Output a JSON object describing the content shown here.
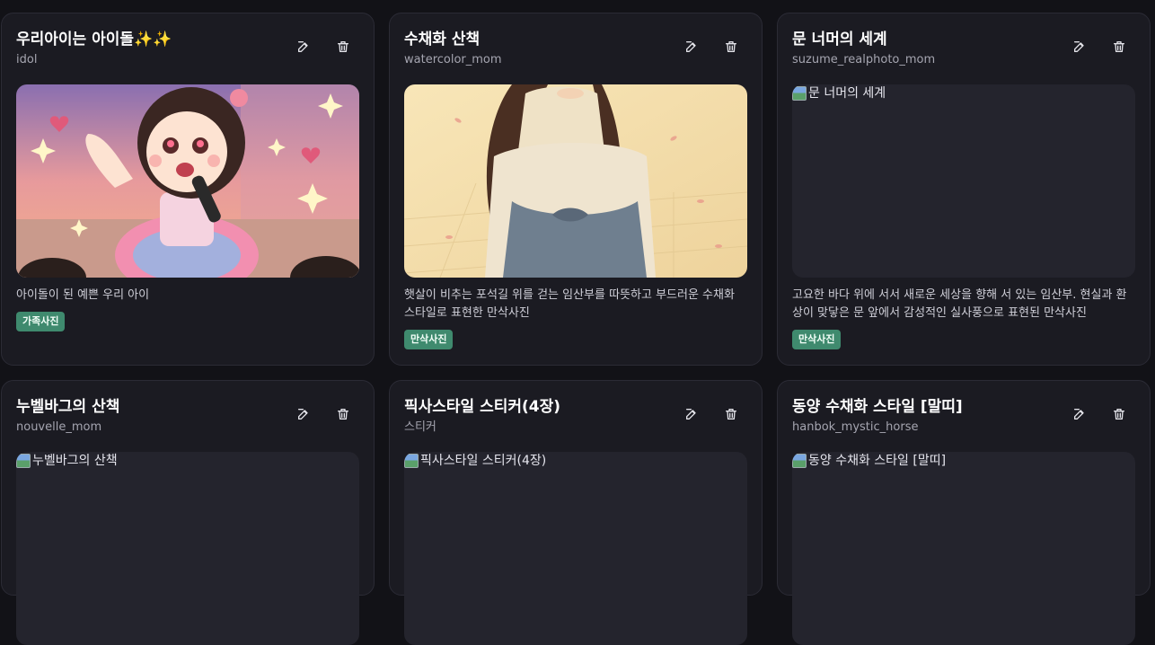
{
  "cards": [
    {
      "title": "우리아이는 아이돌✨✨",
      "author": "idol",
      "description": "아이돌이 된 예쁜 우리 아이",
      "tag": "가족사진",
      "image_alt": ""
    },
    {
      "title": "수채화 산책",
      "author": "watercolor_mom",
      "description": "햇살이 비추는 포석길 위를 걷는 임산부를 따뜻하고 부드러운 수채화 스타일로 표현한 만삭사진",
      "tag": "만삭사진",
      "image_alt": ""
    },
    {
      "title": "문 너머의 세계",
      "author": "suzume_realphoto_mom",
      "description": "고요한 바다 위에 서서 새로운 세상을 향해 서 있는 임산부. 현실과 환상이 맞닿은 문 앞에서 감성적인 실사풍으로 표현된 만삭사진",
      "tag": "만삭사진",
      "image_alt": "문 너머의 세계"
    },
    {
      "title": "누벨바그의 산책",
      "author": "nouvelle_mom",
      "image_alt": "누벨바그의 산책"
    },
    {
      "title": "픽사스타일 스티커(4장)",
      "author": "스티커",
      "image_alt": "픽사스타일 스티커(4장)"
    },
    {
      "title": "동양 수채화 스타일 [말띠]",
      "author": "hanbok_mystic_horse",
      "image_alt": "동양 수채화 스타일 [말띠]"
    }
  ],
  "icons": {
    "edit": "edit-icon",
    "delete": "trash-icon"
  },
  "colors": {
    "background": "#121217",
    "card": "#1b1b22",
    "tag": "#3f8a6e"
  }
}
